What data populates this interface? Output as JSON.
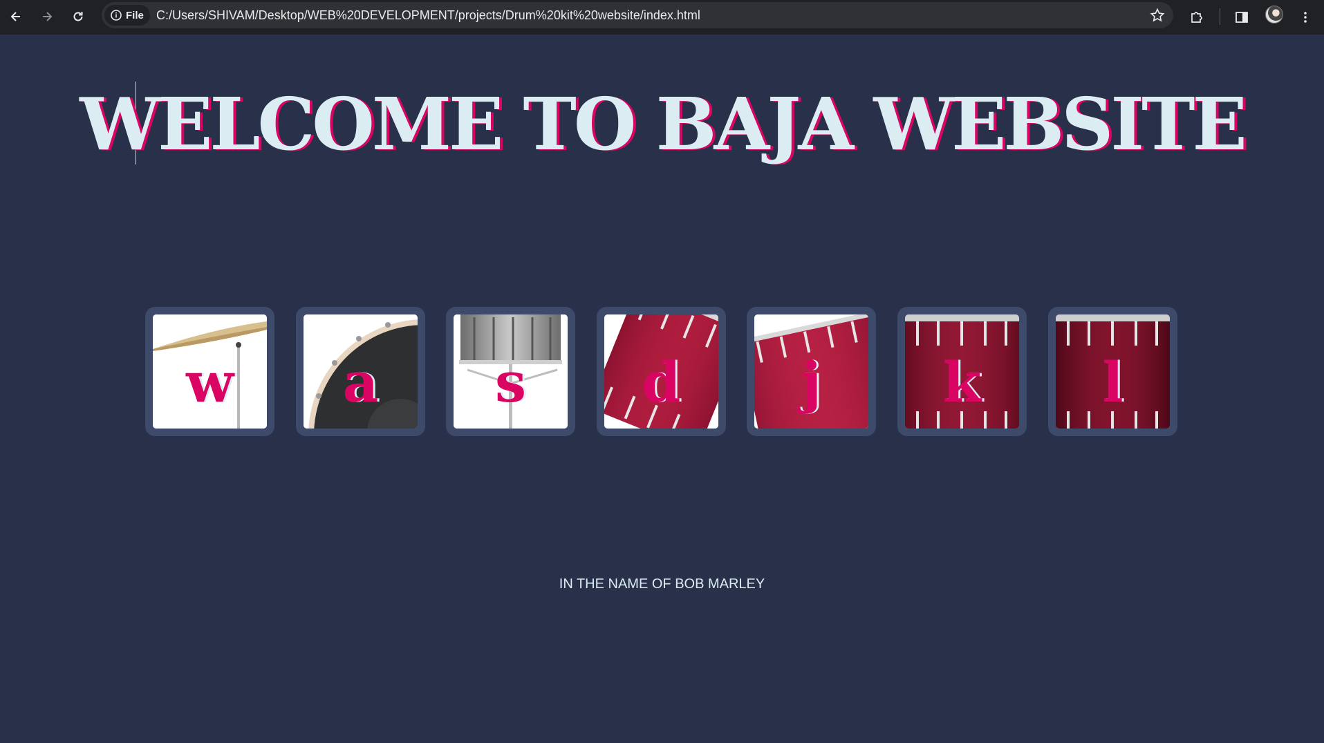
{
  "browser": {
    "site_chip_label": "File",
    "url": "C:/Users/SHIVAM/Desktop/WEB%20DEVELOPMENT/projects/Drum%20kit%20website/index.html"
  },
  "page": {
    "title": "WELCOME TO BAJA WEBSITE",
    "footer": "IN THE NAME OF BOB MARLEY",
    "colors": {
      "background": "#283149",
      "title": "#DBEDF3",
      "accent": "#DA0463"
    }
  },
  "drums": [
    {
      "key": "w",
      "image": "crash-cymbal"
    },
    {
      "key": "a",
      "image": "kick-drum"
    },
    {
      "key": "s",
      "image": "snare-drum"
    },
    {
      "key": "d",
      "image": "tom-1"
    },
    {
      "key": "j",
      "image": "tom-2"
    },
    {
      "key": "k",
      "image": "tom-3"
    },
    {
      "key": "l",
      "image": "tom-4"
    }
  ]
}
